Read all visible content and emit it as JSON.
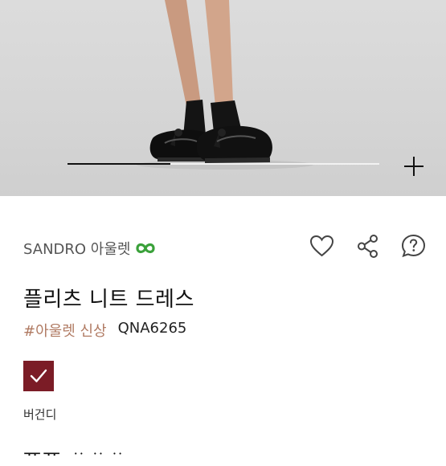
{
  "gallery": {
    "progress": 0.33,
    "expand_icon": "plus-icon"
  },
  "product": {
    "brand": "SANDRO 아울렛",
    "brand_logo_icon": "brand-logo-icon",
    "title": "플리츠 니트 드레스",
    "tag": "#아울렛 신상",
    "code": "QNA6265",
    "color_name": "버건디",
    "swatch_color": "#7b1c26",
    "price_partial": "ᅲᅲ ᆢᆢᆢ"
  },
  "actions": {
    "like_icon": "heart-icon",
    "share_icon": "share-icon",
    "question_icon": "question-bubble-icon"
  },
  "colors": {
    "tag": "#b07a62",
    "logo_green": "#3aa13a"
  }
}
